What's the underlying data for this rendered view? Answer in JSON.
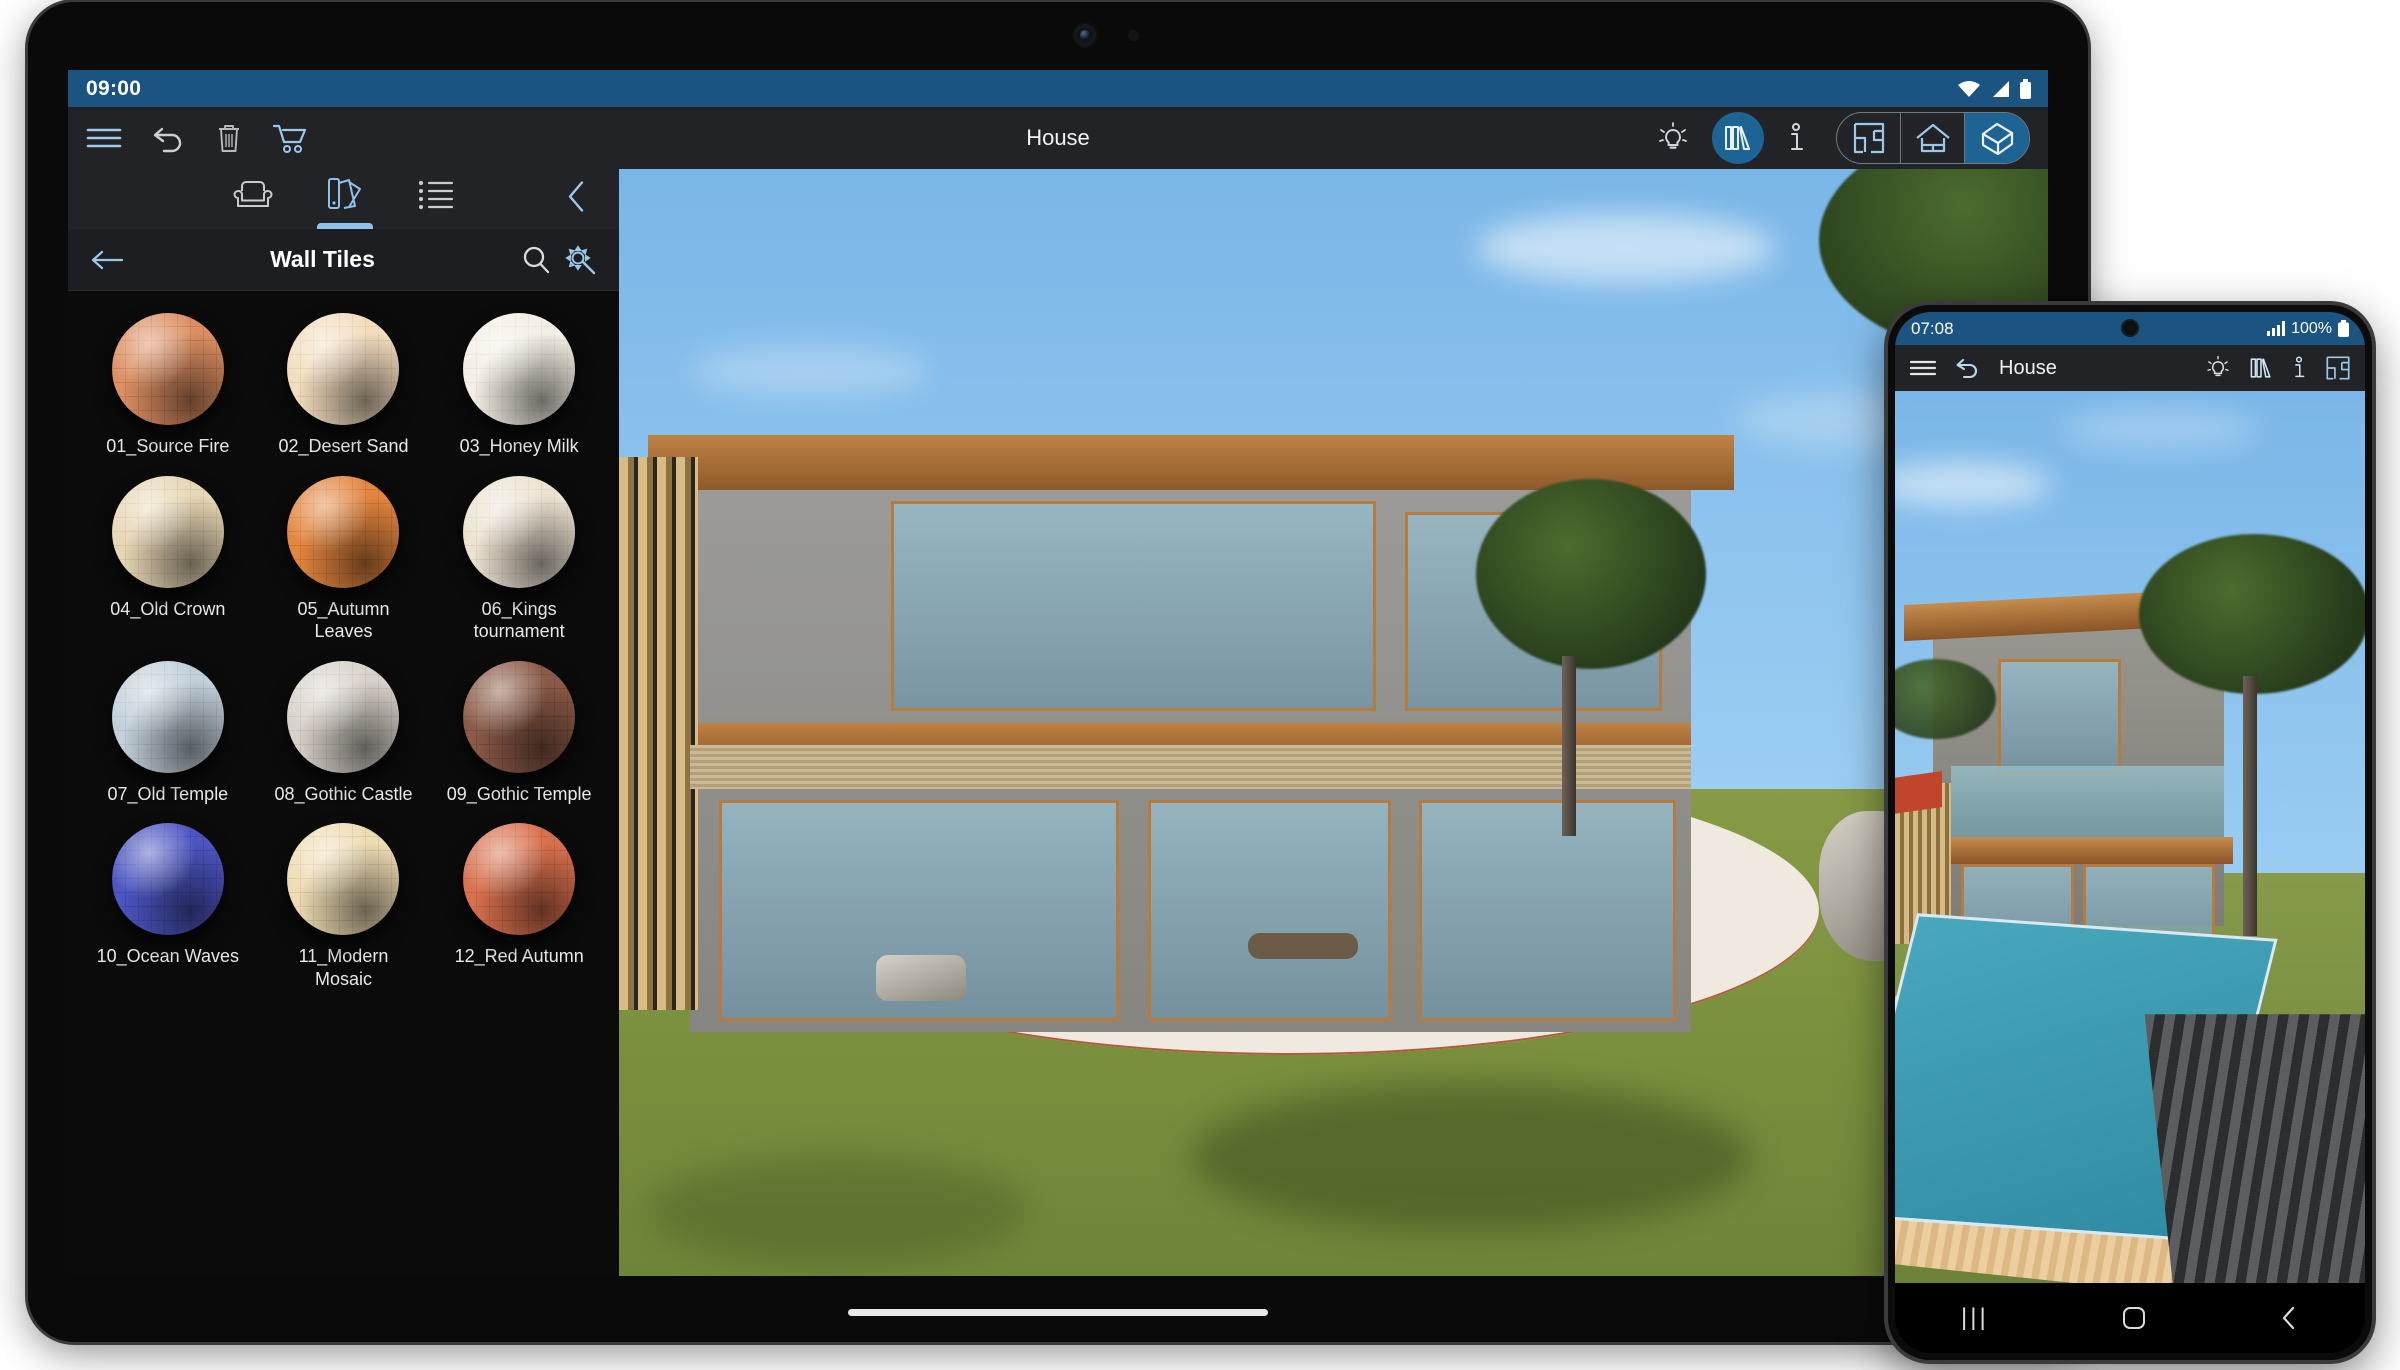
{
  "tablet": {
    "status_bar": {
      "time": "09:00",
      "wifi_icon": "wifi-icon",
      "signal_icon": "signal-icon",
      "battery_icon": "battery-icon"
    },
    "toolbar": {
      "menu_icon": "hamburger-menu-icon",
      "undo_icon": "undo-icon",
      "delete_icon": "trash-icon",
      "cart_icon": "shopping-cart-icon",
      "title": "House",
      "light_icon": "lightbulb-icon",
      "library_icon": "books-library-icon",
      "info_icon": "info-icon",
      "view_2d_icon": "floor-plan-icon",
      "view_elevation_icon": "house-elevation-icon",
      "view_3d_icon": "house-3d-icon",
      "active_view": "view_3d"
    },
    "panel": {
      "tabs": [
        {
          "name": "furniture-tab",
          "icon": "armchair-icon",
          "active": false
        },
        {
          "name": "materials-tab",
          "icon": "color-swatch-fan-icon",
          "active": true
        },
        {
          "name": "list-tab",
          "icon": "bullet-list-icon",
          "active": false
        }
      ],
      "collapse_icon": "chevron-left-icon",
      "back_icon": "arrow-left-icon",
      "title": "Wall Tiles",
      "search_icon": "search-icon",
      "settings_icon": "gear-wand-icon",
      "materials": [
        {
          "label": "01_Source Fire",
          "color": "#dc8f63",
          "accent": "#b0653c"
        },
        {
          "label": "02_Desert Sand",
          "color": "#f3ddc0",
          "accent": "#e0bb8e"
        },
        {
          "label": "03_Honey Milk",
          "color": "#f4efe4",
          "accent": "#ddd4c3"
        },
        {
          "label": "04_Old Crown",
          "color": "#e8d7b6",
          "accent": "#cbb489"
        },
        {
          "label": "05_Autumn Leaves",
          "color": "#e3863f",
          "accent": "#b9632a"
        },
        {
          "label": "06_Kings tournament",
          "color": "#ece3d2",
          "accent": "#d3c6ad"
        },
        {
          "label": "07_Old Temple",
          "color": "#c3d0da",
          "accent": "#9fb0bd"
        },
        {
          "label": "08_Gothic Castle",
          "color": "#d9d2ca",
          "accent": "#b9b0a6"
        },
        {
          "label": "09_Gothic Temple",
          "color": "#8c5b48",
          "accent": "#6a4132"
        },
        {
          "label": "10_Ocean Waves",
          "color": "#4d56c2",
          "accent": "#353ea0"
        },
        {
          "label": "11_Modern Mosaic",
          "color": "#eedcb4",
          "accent": "#cdb27f"
        },
        {
          "label": "12_Red Autumn",
          "color": "#d9714e",
          "accent": "#b25238"
        }
      ]
    },
    "viewport": {
      "name": "3d-scene-viewport",
      "description": "Modern house exterior 3D render with lawn, trees and rock garden",
      "sky_color": "#8ec4ee",
      "lawn_color": "#7e9340",
      "wood_color": "#b06e32",
      "concrete_color": "#908f8a"
    },
    "home_indicator": "home-indicator-bar"
  },
  "phone": {
    "status_bar": {
      "time": "07:08",
      "signal_icon": "signal-bars-icon",
      "battery_label": "100%",
      "battery_icon": "battery-icon"
    },
    "toolbar": {
      "menu_icon": "hamburger-menu-icon",
      "undo_icon": "undo-icon",
      "title": "House",
      "light_icon": "lightbulb-icon",
      "library_icon": "books-library-icon",
      "info_icon": "info-icon",
      "view_2d_icon": "floor-plan-icon"
    },
    "viewport": {
      "name": "3d-scene-viewport",
      "description": "Modern house with swimming pool, wooden deck and stone path",
      "pool_color": "#3d9cb3",
      "deck_color": "#e3c18e"
    },
    "nav_bar": {
      "recents_label": "|||",
      "home_icon": "home-square-icon",
      "back_icon": "chevron-left-icon"
    }
  },
  "theme": {
    "status_blue": "#1b5480",
    "toolbar_dark": "#212327",
    "panel_dark": "#0b0b0c",
    "accent_blue": "#8ec2ea",
    "active_blue": "#1d6394"
  }
}
